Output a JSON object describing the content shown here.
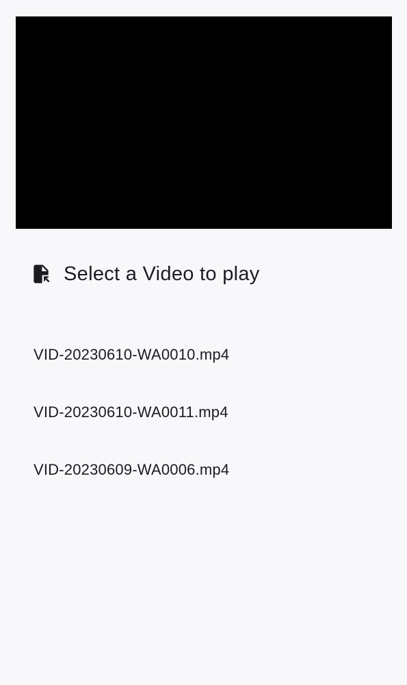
{
  "player": {
    "background": "#000000"
  },
  "select_video": {
    "icon": "file-select-icon",
    "label": "Select a Video to play"
  },
  "videos": [
    {
      "name": "VID-20230610-WA0010.mp4"
    },
    {
      "name": "VID-20230610-WA0011.mp4"
    },
    {
      "name": "VID-20230609-WA0006.mp4"
    }
  ],
  "colors": {
    "background": "#f8f7fa",
    "text": "#1c1b1f"
  }
}
